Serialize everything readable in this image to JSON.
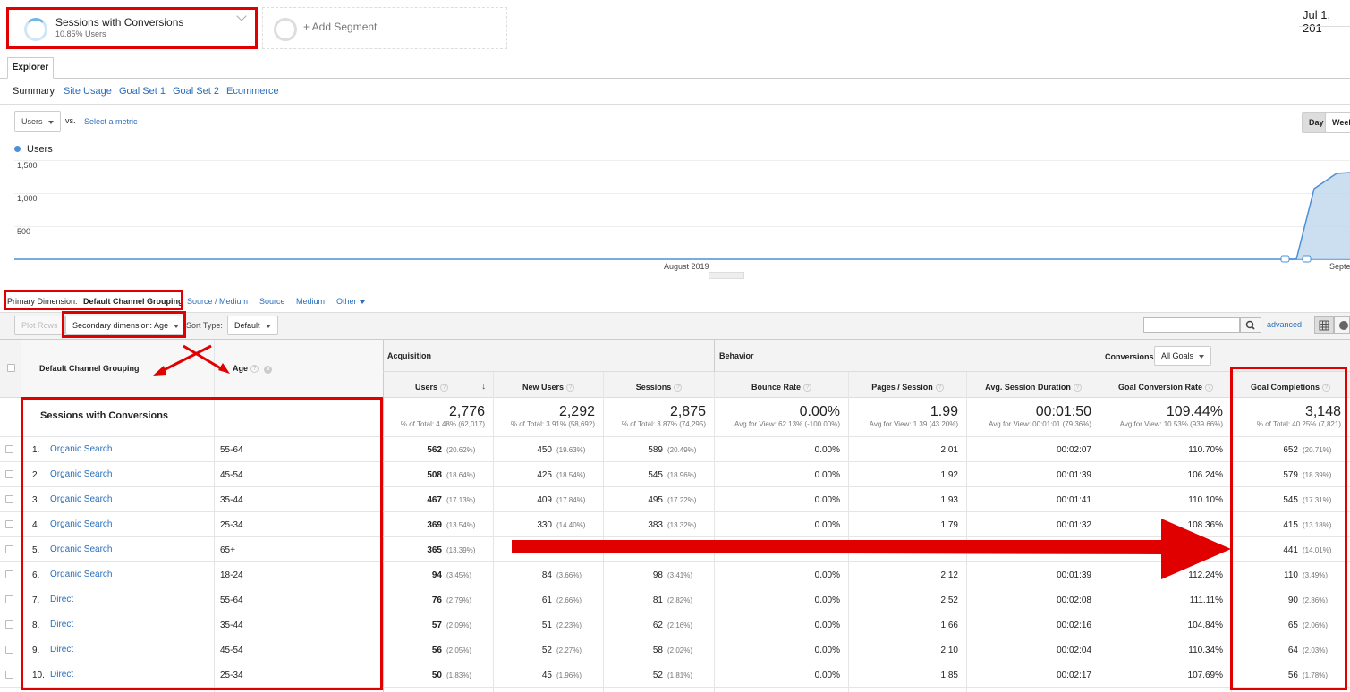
{
  "segments": {
    "active": {
      "name": "Sessions with Conversions",
      "sub": "10.85% Users"
    },
    "add_label": "+ Add Segment"
  },
  "date_range": "Jul 1, 201",
  "tabs": {
    "explorer": "Explorer"
  },
  "subnav": [
    "Summary",
    "Site Usage",
    "Goal Set 1",
    "Goal Set 2",
    "Ecommerce"
  ],
  "chart_controls": {
    "metric": "Users",
    "vs": "vs.",
    "select_metric": "Select a metric",
    "day": "Day",
    "week": "Week"
  },
  "chart_data": {
    "type": "line",
    "legend": "Users",
    "ylim": [
      0,
      1500
    ],
    "yticks": [
      "1,500",
      "1,000",
      "500"
    ],
    "xlabels": [
      "August 2019",
      "Septe"
    ],
    "series": [
      {
        "name": "Users",
        "color": "#4d90d6"
      }
    ],
    "visible_points_note": "flat near 0 until early September, then rising to ~1,270 and ~1,310"
  },
  "dimensions": {
    "primary_label": "Primary Dimension:",
    "primary_value": "Default Channel Grouping",
    "options": [
      "Source / Medium",
      "Source",
      "Medium",
      "Other"
    ]
  },
  "toolbar": {
    "plot_rows": "Plot Rows",
    "secondary": "Secondary dimension: Age",
    "sort_type_label": "Sort Type:",
    "sort_type": "Default",
    "advanced": "advanced"
  },
  "table": {
    "col_dim1": "Default Channel Grouping",
    "col_dim2": "Age",
    "groups": {
      "acquisition": "Acquisition",
      "behavior": "Behavior",
      "conversions": "Conversions",
      "goals": "All Goals"
    },
    "columns": [
      "Users",
      "New Users",
      "Sessions",
      "Bounce Rate",
      "Pages / Session",
      "Avg. Session Duration",
      "Goal Conversion Rate",
      "Goal Completions"
    ],
    "segment_label": "Sessions with Conversions",
    "totals": [
      {
        "big": "2,776",
        "small": "% of Total: 4.48% (62,017)"
      },
      {
        "big": "2,292",
        "small": "% of Total: 3.91% (58,692)"
      },
      {
        "big": "2,875",
        "small": "% of Total: 3.87% (74,295)"
      },
      {
        "big": "0.00%",
        "small": "Avg for View: 62.13% (-100.00%)"
      },
      {
        "big": "1.99",
        "small": "Avg for View: 1.39 (43.20%)"
      },
      {
        "big": "00:01:50",
        "small": "Avg for View: 00:01:01 (79.36%)"
      },
      {
        "big": "109.44%",
        "small": "Avg for View: 10.53% (939.66%)"
      },
      {
        "big": "3,148",
        "small": "% of Total: 40.25% (7,821)"
      }
    ],
    "rows": [
      {
        "n": "1.",
        "channel": "Organic Search",
        "age": "55-64",
        "users": "562",
        "users_p": "(20.62%)",
        "new": "450",
        "new_p": "(19.63%)",
        "sess": "589",
        "sess_p": "(20.49%)",
        "bounce": "0.00%",
        "pps": "2.01",
        "dur": "00:02:07",
        "gcr": "110.70%",
        "gc": "652",
        "gc_p": "(20.71%)"
      },
      {
        "n": "2.",
        "channel": "Organic Search",
        "age": "45-54",
        "users": "508",
        "users_p": "(18.64%)",
        "new": "425",
        "new_p": "(18.54%)",
        "sess": "545",
        "sess_p": "(18.96%)",
        "bounce": "0.00%",
        "pps": "1.92",
        "dur": "00:01:39",
        "gcr": "106.24%",
        "gc": "579",
        "gc_p": "(18.39%)"
      },
      {
        "n": "3.",
        "channel": "Organic Search",
        "age": "35-44",
        "users": "467",
        "users_p": "(17.13%)",
        "new": "409",
        "new_p": "(17.84%)",
        "sess": "495",
        "sess_p": "(17.22%)",
        "bounce": "0.00%",
        "pps": "1.93",
        "dur": "00:01:41",
        "gcr": "110.10%",
        "gc": "545",
        "gc_p": "(17.31%)"
      },
      {
        "n": "4.",
        "channel": "Organic Search",
        "age": "25-34",
        "users": "369",
        "users_p": "(13.54%)",
        "new": "330",
        "new_p": "(14.40%)",
        "sess": "383",
        "sess_p": "(13.32%)",
        "bounce": "0.00%",
        "pps": "1.79",
        "dur": "00:01:32",
        "gcr": "108.36%",
        "gc": "415",
        "gc_p": "(13.18%)"
      },
      {
        "n": "5.",
        "channel": "Organic Search",
        "age": "65+",
        "users": "365",
        "users_p": "(13.39%)",
        "new": "",
        "new_p": "",
        "sess": "",
        "sess_p": "",
        "bounce": "",
        "pps": "",
        "dur": "",
        "gcr": "",
        "gc": "441",
        "gc_p": "(14.01%)"
      },
      {
        "n": "6.",
        "channel": "Organic Search",
        "age": "18-24",
        "users": "94",
        "users_p": "(3.45%)",
        "new": "84",
        "new_p": "(3.66%)",
        "sess": "98",
        "sess_p": "(3.41%)",
        "bounce": "0.00%",
        "pps": "2.12",
        "dur": "00:01:39",
        "gcr": "112.24%",
        "gc": "110",
        "gc_p": "(3.49%)"
      },
      {
        "n": "7.",
        "channel": "Direct",
        "age": "55-64",
        "users": "76",
        "users_p": "(2.79%)",
        "new": "61",
        "new_p": "(2.66%)",
        "sess": "81",
        "sess_p": "(2.82%)",
        "bounce": "0.00%",
        "pps": "2.52",
        "dur": "00:02:08",
        "gcr": "111.11%",
        "gc": "90",
        "gc_p": "(2.86%)"
      },
      {
        "n": "8.",
        "channel": "Direct",
        "age": "35-44",
        "users": "57",
        "users_p": "(2.09%)",
        "new": "51",
        "new_p": "(2.23%)",
        "sess": "62",
        "sess_p": "(2.16%)",
        "bounce": "0.00%",
        "pps": "1.66",
        "dur": "00:02:16",
        "gcr": "104.84%",
        "gc": "65",
        "gc_p": "(2.06%)"
      },
      {
        "n": "9.",
        "channel": "Direct",
        "age": "45-54",
        "users": "56",
        "users_p": "(2.05%)",
        "new": "52",
        "new_p": "(2.27%)",
        "sess": "58",
        "sess_p": "(2.02%)",
        "bounce": "0.00%",
        "pps": "2.10",
        "dur": "00:02:04",
        "gcr": "110.34%",
        "gc": "64",
        "gc_p": "(2.03%)"
      },
      {
        "n": "10.",
        "channel": "Direct",
        "age": "25-34",
        "users": "50",
        "users_p": "(1.83%)",
        "new": "45",
        "new_p": "(1.96%)",
        "sess": "52",
        "sess_p": "(1.81%)",
        "bounce": "0.00%",
        "pps": "1.85",
        "dur": "00:02:17",
        "gcr": "107.69%",
        "gc": "56",
        "gc_p": "(1.78%)"
      }
    ]
  },
  "colors": {
    "accent": "#2a6ebb",
    "annotation": "#e10000",
    "line": "#4d90d6"
  }
}
